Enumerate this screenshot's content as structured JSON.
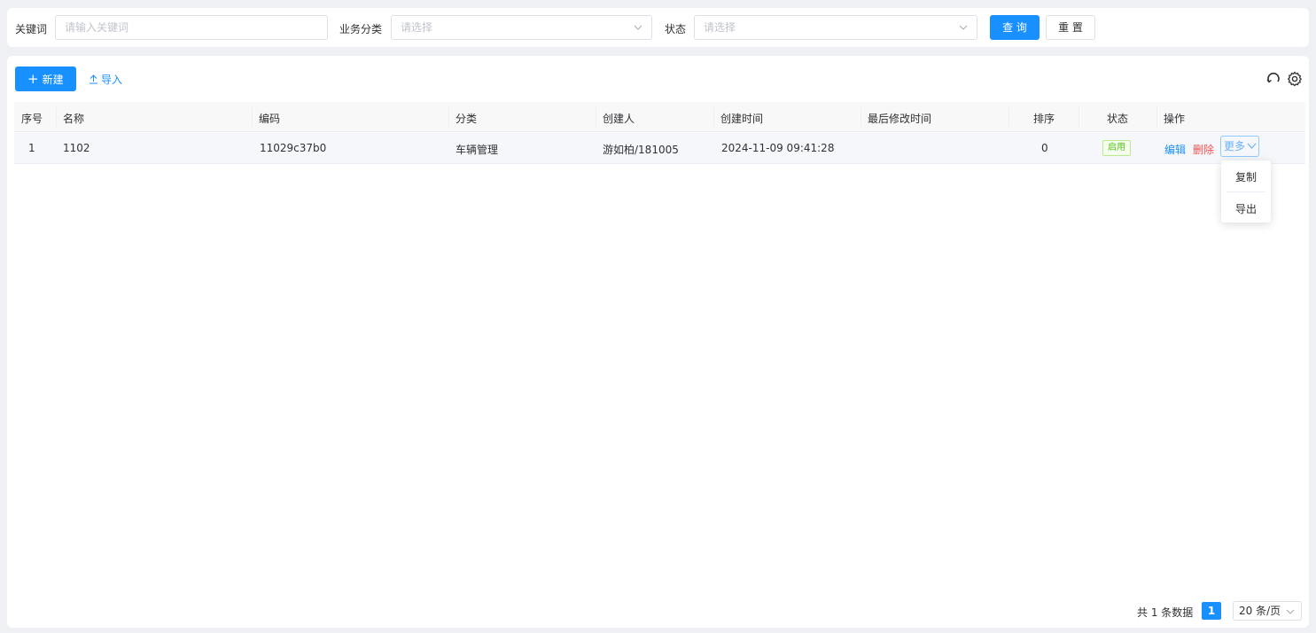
{
  "filters": {
    "keyword_label": "关键词",
    "keyword_placeholder": "请输入关键词",
    "category_label": "业务分类",
    "category_placeholder": "请选择",
    "status_label": "状态",
    "status_placeholder": "请选择",
    "query_button": "查 询",
    "reset_button": "重 置"
  },
  "toolbar": {
    "new_button": "新建",
    "import_button": "导入",
    "icons": [
      "refresh-icon",
      "gear-icon"
    ]
  },
  "table": {
    "columns": [
      "序号",
      "名称",
      "编码",
      "分类",
      "创建人",
      "创建时间",
      "最后修改时间",
      "排序",
      "状态",
      "操作"
    ],
    "rows": [
      {
        "index": "1",
        "name": "1102",
        "code": "11029c37b0",
        "category": "车辆管理",
        "creator": "游如柏/181005",
        "created_at": "2024-11-09 09:41:28",
        "modified_at": "",
        "sort": "0",
        "status": "启用",
        "actions": {
          "edit": "编辑",
          "delete": "删除",
          "more": "更多"
        }
      }
    ]
  },
  "more_menu": {
    "items": [
      "复制",
      "导出"
    ]
  },
  "pagination": {
    "total_text": "共 1 条数据",
    "current_page": "1",
    "page_size": "20 条/页"
  },
  "colors": {
    "primary": "#1890ff",
    "danger": "#ff4d4f",
    "success": "#52c41a",
    "background": "#eef0f3"
  }
}
